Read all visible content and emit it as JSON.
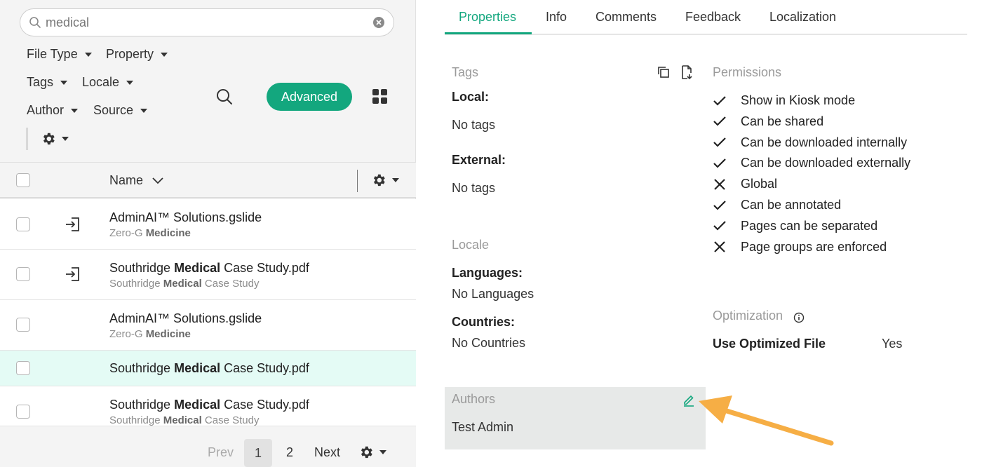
{
  "search": {
    "value": "medical"
  },
  "filters": {
    "file_type": "File Type",
    "property": "Property",
    "tags": "Tags",
    "locale": "Locale",
    "author": "Author",
    "source": "Source"
  },
  "toolbar": {
    "advanced_label": "Advanced"
  },
  "table": {
    "name_header": "Name",
    "rows": [
      {
        "title_pre": "AdminAI™ Solutions.gslide",
        "title_bold": "",
        "title_post": "",
        "sub_pre": "Zero-G ",
        "sub_bold": "Medicine",
        "sub_post": ""
      },
      {
        "title_pre": "Southridge ",
        "title_bold": "Medical",
        "title_post": " Case Study.pdf",
        "sub_pre": "Southridge ",
        "sub_bold": "Medical",
        "sub_post": " Case Study"
      },
      {
        "title_pre": "AdminAI™ Solutions.gslide",
        "title_bold": "",
        "title_post": "",
        "sub_pre": "Zero-G ",
        "sub_bold": "Medicine",
        "sub_post": ""
      },
      {
        "title_pre": "Southridge ",
        "title_bold": "Medical",
        "title_post": " Case Study.pdf"
      },
      {
        "title_pre": "Southridge ",
        "title_bold": "Medical",
        "title_post": " Case Study.pdf",
        "sub_pre": "Southridge ",
        "sub_bold": "Medical",
        "sub_post": " Case Study"
      }
    ]
  },
  "pager": {
    "prev": "Prev",
    "page1": "1",
    "page2": "2",
    "next": "Next"
  },
  "tabs": [
    "Properties",
    "Info",
    "Comments",
    "Feedback",
    "Localization"
  ],
  "tags": {
    "title": "Tags",
    "local_label": "Local:",
    "local_value": "No tags",
    "external_label": "External:",
    "external_value": "No tags"
  },
  "locale": {
    "title": "Locale",
    "languages_label": "Languages:",
    "languages_value": "No Languages",
    "countries_label": "Countries:",
    "countries_value": "No Countries"
  },
  "authors": {
    "title": "Authors",
    "value": "Test Admin"
  },
  "permissions": {
    "title": "Permissions",
    "items": [
      {
        "label": "Show in Kiosk mode",
        "state": "check"
      },
      {
        "label": "Can be shared",
        "state": "check"
      },
      {
        "label": "Can be downloaded internally",
        "state": "check"
      },
      {
        "label": "Can be downloaded externally",
        "state": "check"
      },
      {
        "label": "Global",
        "state": "cross"
      },
      {
        "label": "Can be annotated",
        "state": "check"
      },
      {
        "label": "Pages can be separated",
        "state": "check"
      },
      {
        "label": "Page groups are enforced",
        "state": "cross"
      }
    ]
  },
  "optimization": {
    "title": "Optimization",
    "label": "Use Optimized File",
    "value": "Yes"
  },
  "colors": {
    "accent": "#13a77e",
    "arrow": "#f6ae45"
  }
}
